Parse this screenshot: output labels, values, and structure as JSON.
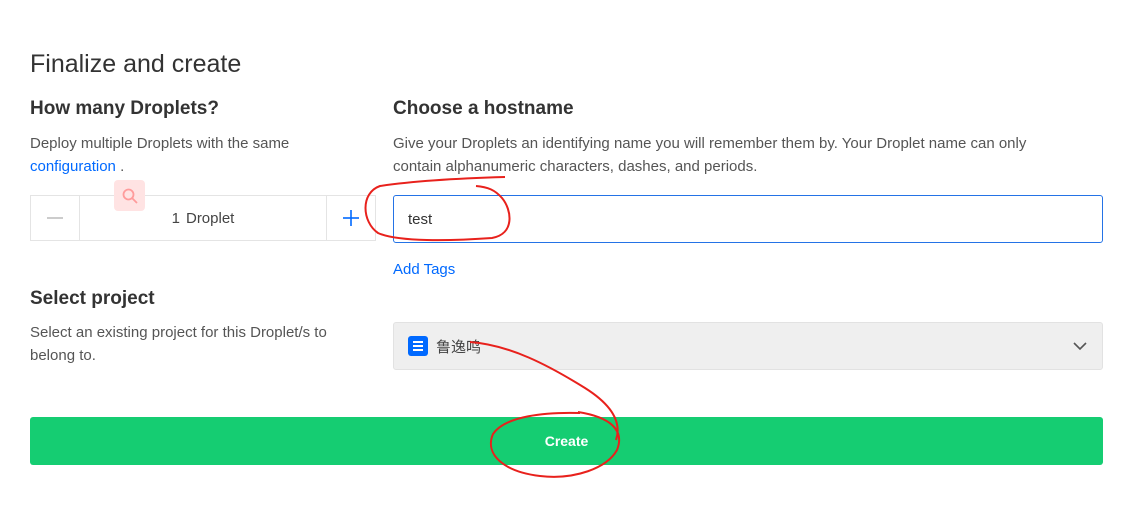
{
  "page": {
    "title": "Finalize and create"
  },
  "droplets": {
    "title": "How many Droplets?",
    "description": "Deploy multiple Droplets with the same",
    "link": "configuration",
    "description_end": ".",
    "minus_icon": "minus-icon",
    "plus_icon": "plus-icon",
    "count": "1",
    "unit": "Droplet"
  },
  "hostname": {
    "title": "Choose a hostname",
    "description_line1": "Give your Droplets an identifying name you will remember them by. Your Droplet name can only",
    "description_line2": "contain alphanumeric characters, dashes, and periods.",
    "value": "test",
    "add_tags": "Add Tags"
  },
  "project": {
    "title": "Select project",
    "description_line1": "Select an existing project for this Droplet/s to",
    "description_line2": "belong to.",
    "selected": "鲁逸鸣",
    "icon": "project-icon"
  },
  "create": {
    "label": "Create"
  },
  "colors": {
    "accent": "#0069ff",
    "create_bg": "#15cd72",
    "annotation": "#e8211c"
  }
}
